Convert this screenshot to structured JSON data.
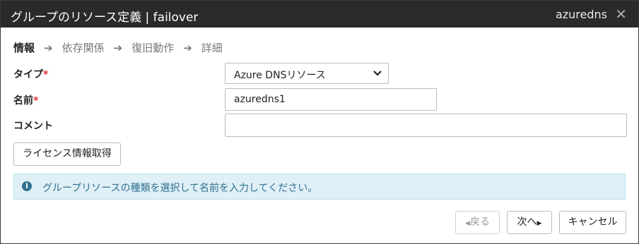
{
  "dialog": {
    "title": "グループのリソース定義 | failover",
    "resource_name": "azuredns",
    "close_glyph": "✕"
  },
  "steps": [
    {
      "label": "情報"
    },
    {
      "label": "依存関係"
    },
    {
      "label": "復旧動作"
    },
    {
      "label": "詳細"
    }
  ],
  "form": {
    "type_label": "タイプ",
    "type_value": "Azure DNSリソース",
    "name_label": "名前",
    "name_value": "azuredns1",
    "comment_label": "コメント",
    "comment_value": "",
    "required_mark": "*"
  },
  "license_button": "ライセンス情報取得",
  "info": {
    "icon": "i",
    "message": "グループリソースの種類を選択して名前を入力してください。"
  },
  "footer": {
    "back_label": "戻る",
    "next_label": "次へ",
    "cancel_label": "キャンセル"
  }
}
